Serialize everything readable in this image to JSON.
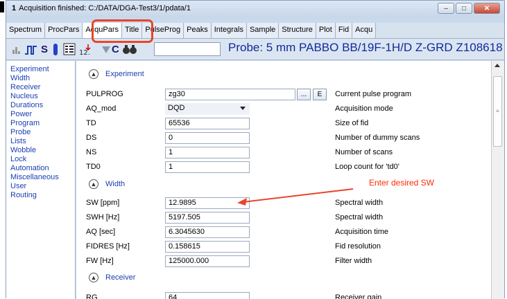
{
  "window": {
    "title_prefix": "1",
    "title": "Acquisition finished: C:/DATA/DGA-Test3/1/pdata/1",
    "buttons": {
      "minimize": "–",
      "maximize": "□",
      "close": "✕"
    }
  },
  "tabs": [
    "Spectrum",
    "ProcPars",
    "AcquPars",
    "Title",
    "PulseProg",
    "Peaks",
    "Integrals",
    "Sample",
    "Structure",
    "Plot",
    "Fid",
    "Acqu"
  ],
  "active_tab": "AcquPars",
  "toolbar": {
    "probe_text": "Probe: 5 mm PABBO BB/19F-1H/D Z-GRD Z108618"
  },
  "sidebar": [
    "Experiment",
    "Width",
    "Receiver",
    "Nucleus",
    "Durations",
    "Power",
    "Program",
    "Probe",
    "Lists",
    "Wobble",
    "Lock",
    "Automation",
    "Miscellaneous",
    "User",
    "Routing"
  ],
  "sections": {
    "experiment": "Experiment",
    "width": "Width",
    "receiver": "Receiver"
  },
  "experiment_params": [
    {
      "name": "PULPROG",
      "value": "zg30",
      "desc": "Current pulse program"
    },
    {
      "name": "AQ_mod",
      "value": "DQD",
      "desc": "Acquisition mode"
    },
    {
      "name": "TD",
      "value": "65536",
      "desc": "Size of fid"
    },
    {
      "name": "DS",
      "value": "0",
      "desc": "Number of dummy scans"
    },
    {
      "name": "NS",
      "value": "1",
      "desc": "Number of scans"
    },
    {
      "name": "TD0",
      "value": "1",
      "desc": "Loop count for 'td0'"
    }
  ],
  "width_params": [
    {
      "name": "SW [ppm]",
      "value": "12.9895",
      "desc": "Spectral width"
    },
    {
      "name": "SWH [Hz]",
      "value": "5197.505",
      "desc": "Spectral width"
    },
    {
      "name": "AQ [sec]",
      "value": "6.3045630",
      "desc": "Acquisition time"
    },
    {
      "name": "FIDRES [Hz]",
      "value": "0.158615",
      "desc": "Fid resolution"
    },
    {
      "name": "FW [Hz]",
      "value": "125000.000",
      "desc": "Filter width"
    }
  ],
  "receiver_params": [
    {
      "name": "RG",
      "value": "64",
      "desc": "Receiver gain"
    }
  ],
  "pulprog_buttons": {
    "browse": "...",
    "edit": "E"
  },
  "annotation": {
    "text": "Enter desired SW",
    "color": "#ff2a00"
  },
  "colors": {
    "highlight": "#e8452a",
    "link_blue": "#1a3fb0",
    "probe_blue": "#102a9a"
  },
  "icons": [
    "small-spectrum-icon",
    "pulse-icon",
    "s-icon",
    "tube-icon",
    "table-icon",
    "list-icon",
    "triangle-icon",
    "c-icon",
    "binoculars-icon"
  ]
}
